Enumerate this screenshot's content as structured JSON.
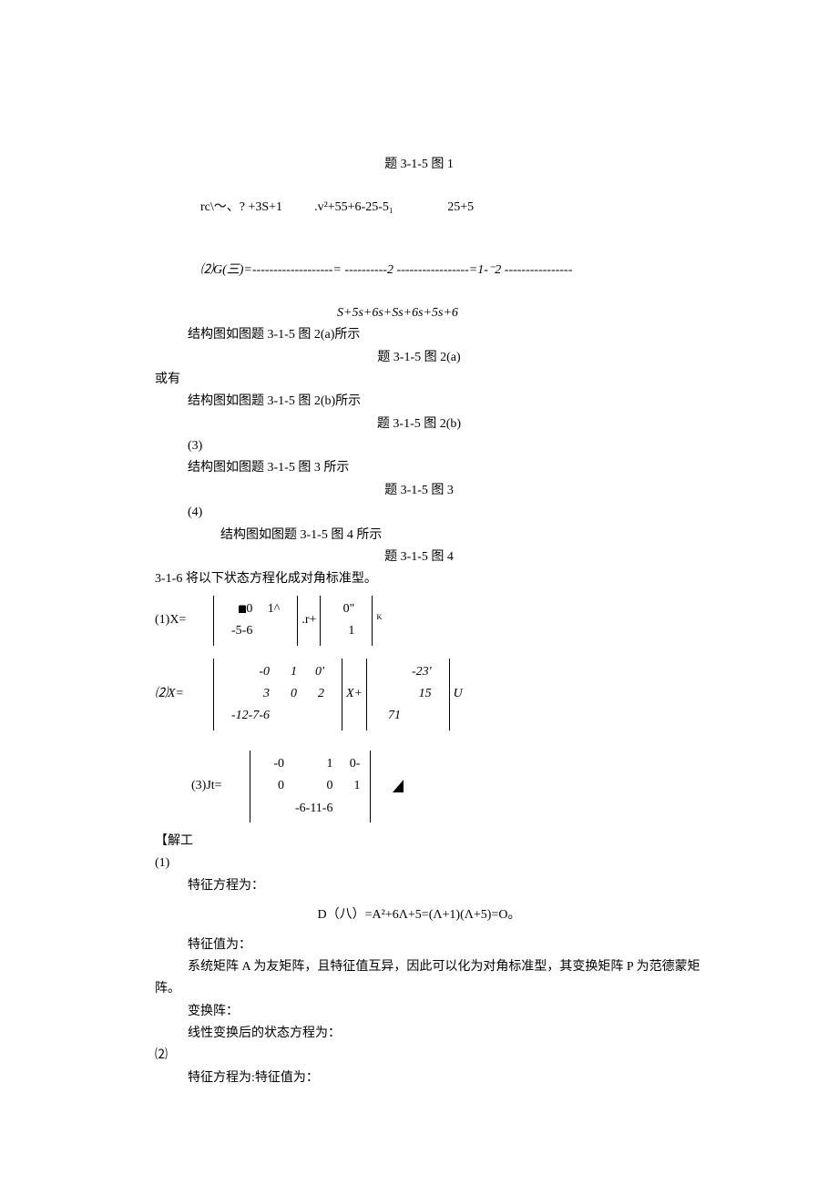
{
  "fig1_caption": "题 3-1-5 图 1",
  "g_expr_top_left": "rc\\～、? +3S+1",
  "g_expr_top_mid": ".v²+55+6-25-5₁",
  "g_expr_top_right": "25+5",
  "g_expr_label": "⑵G(三)=-",
  "g_expr_line_mid": "------------------= ----------2 -----------------=1-⁻2 ----------------",
  "g_expr_denom": "S+5s+6s+Ss+6s+5s+6",
  "struct_2a": "结构图如图题 3-1-5 图 2(a)所示",
  "fig2a_caption": "题 3-1-5 图 2(a)",
  "or_have": "或有",
  "struct_2b": "结构图如图题 3-1-5 图 2(b)所示",
  "fig2b_caption": "题 3-1-5 图 2(b)",
  "item3_marker": "(3)",
  "struct_3": "结构图如图题 3-1-5 图 3 所示",
  "fig3_caption": "题 3-1-5 图 3",
  "item4_marker": "(4)",
  "struct_4": "结构图如图题 3-1-5 图 4 所示",
  "fig4_caption": "题 3-1-5 图 4",
  "q316_title": "3-1-6 将以下状态方程化成对角标准型。",
  "eq1_lbl": "(1)X=",
  "eq1_A": [
    [
      "■0",
      "1^"
    ],
    [
      "-5-6",
      ""
    ]
  ],
  "eq1_mid": ".r+",
  "eq1_B": [
    [
      "0\""
    ],
    [
      "1"
    ]
  ],
  "eq1_tail": "ᴷ",
  "eq2_lbl": "⑵X=",
  "eq2_A": [
    [
      "-0",
      "1",
      "0'"
    ],
    [
      "3",
      "0",
      "2"
    ],
    [
      "-12-7-6",
      "",
      ""
    ]
  ],
  "eq2_mid": "X+",
  "eq2_B": [
    [
      "",
      "-23'"
    ],
    [
      "",
      "15"
    ],
    [
      "71",
      ""
    ]
  ],
  "eq2_tail": "U",
  "eq3_lbl": "(3)Jt=",
  "eq3_A": [
    [
      "-0",
      "1",
      "0-"
    ],
    [
      "0",
      "0",
      "1"
    ],
    [
      "",
      "-6-11-6",
      ""
    ]
  ],
  "jiegong": "【解工",
  "sec1_marker": "(1)",
  "char_eq_label": "特征方程为：",
  "char_eq": "D（八）=A²+6Λ+5=(Λ+1)(Λ+5)=O。",
  "eigen_label": "特征值为：",
  "friend_text": "系统矩阵 A 为友矩阵，且特征值互异，因此可以化为对角标准型，其变换矩阵 P 为范德蒙矩",
  "friend_tail": "阵。",
  "transform_label": "变换阵：",
  "after_transform": "线性变换后的状态方程为：",
  "sec2_marker": "⑵",
  "char_eq_label2": "特征方程为:特征值为："
}
